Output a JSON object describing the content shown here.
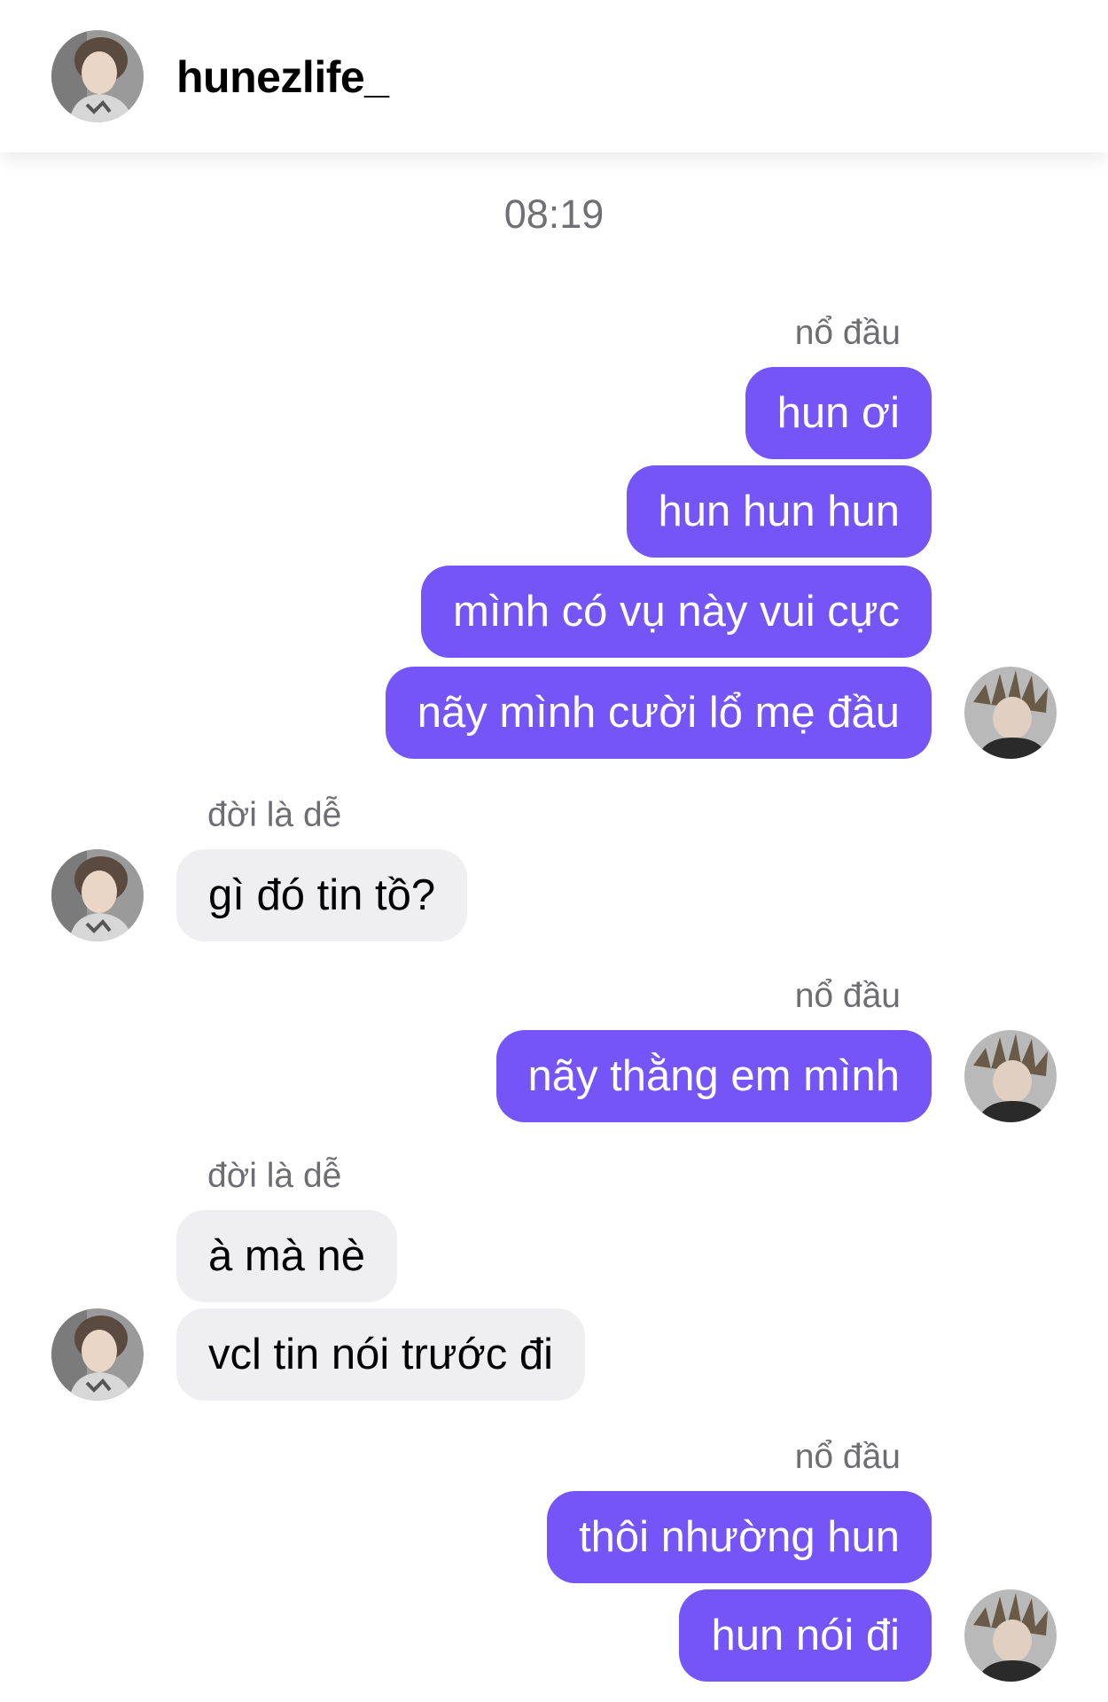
{
  "header": {
    "username": "hunezlife_"
  },
  "chat": {
    "timestamp": "08:19",
    "messages": [
      {
        "sender": "nổ đầu",
        "text": "hun ơi"
      },
      {
        "text": "hun hun hun"
      },
      {
        "text": "mình có vụ này vui cực"
      },
      {
        "text": "nãy mình cười lổ mẹ đầu"
      },
      {
        "sender": "đời là dễ",
        "text": "gì đó tin tồ?"
      },
      {
        "sender": "nổ đầu",
        "text": "nãy thằng em mình"
      },
      {
        "sender": "đời là dễ",
        "text": "à mà nè"
      },
      {
        "text": "vcl tin nói trước đi"
      },
      {
        "sender": "nổ đầu",
        "text": "thôi nhường hun"
      },
      {
        "text": "hun nói đi"
      }
    ]
  },
  "colors": {
    "outgoing_bubble": "#7555f8",
    "incoming_bubble": "#efeff1",
    "secondary_text": "#6d6d72"
  }
}
